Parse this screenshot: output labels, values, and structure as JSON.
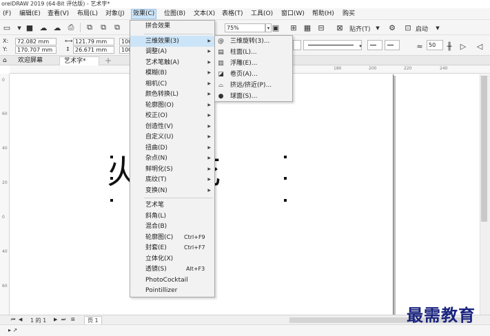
{
  "title": "orelDRAW 2019 (64-Bit 评估版) - 艺术字*",
  "menubar": [
    {
      "label": "(F)"
    },
    {
      "label": "编辑(E)"
    },
    {
      "label": "查看(V)"
    },
    {
      "label": "布局(L)"
    },
    {
      "label": "对象(J)"
    },
    {
      "label": "效果(C)"
    },
    {
      "label": "位图(B)"
    },
    {
      "label": "文本(X)"
    },
    {
      "label": "表格(T)"
    },
    {
      "label": "工具(O)"
    },
    {
      "label": "窗口(W)"
    },
    {
      "label": "帮助(H)"
    },
    {
      "label": "购买"
    }
  ],
  "toolbar": {
    "zoom_value": "75%",
    "align_label": "贴齐(T)",
    "launch_label": "启动"
  },
  "propbar": {
    "x_label": "X:",
    "x_value": "72.082 mm",
    "y_label": "Y:",
    "y_value": "170.707 mm",
    "w_value": "121.79 mm",
    "h_value": "26.671 mm",
    "scale1": "100",
    "scale2": "100",
    "spin_value": "50"
  },
  "tabs": [
    {
      "label": "欢迎屏幕"
    },
    {
      "label": "艺术字*"
    }
  ],
  "hruler_nums": [
    "180",
    "200",
    "220",
    "240"
  ],
  "vruler_nums": [
    "0",
    "60",
    "40",
    "20",
    "0",
    "40",
    "60"
  ],
  "canvas": {
    "art_text": "火 银花"
  },
  "effects_menu": {
    "items": [
      {
        "label": "拼合效果",
        "arrow": ""
      },
      {
        "label": "三维效果(3)",
        "arrow": "▶"
      },
      {
        "label": "调整(A)",
        "arrow": "▶"
      },
      {
        "label": "艺术笔触(A)",
        "arrow": "▶"
      },
      {
        "label": "模糊(B)",
        "arrow": "▶"
      },
      {
        "label": "相机(C)",
        "arrow": "▶"
      },
      {
        "label": "颜色转换(L)",
        "arrow": "▶"
      },
      {
        "label": "轮廓图(O)",
        "arrow": "▶"
      },
      {
        "label": "校正(O)",
        "arrow": "▶"
      },
      {
        "label": "创造性(V)",
        "arrow": "▶"
      },
      {
        "label": "自定义(U)",
        "arrow": "▶"
      },
      {
        "label": "扭曲(D)",
        "arrow": "▶"
      },
      {
        "label": "杂点(N)",
        "arrow": "▶"
      },
      {
        "label": "鲜明化(S)",
        "arrow": "▶"
      },
      {
        "label": "底纹(T)",
        "arrow": "▶"
      },
      {
        "label": "变换(N)",
        "arrow": "▶"
      }
    ],
    "items2": [
      {
        "label": "艺术笔",
        "shortcut": ""
      },
      {
        "label": "斜角(L)",
        "shortcut": ""
      },
      {
        "label": "混合(B)",
        "shortcut": ""
      },
      {
        "label": "轮廓图(C)",
        "shortcut": "Ctrl+F9"
      },
      {
        "label": "封套(E)",
        "shortcut": "Ctrl+F7"
      },
      {
        "label": "立体化(X)",
        "shortcut": ""
      },
      {
        "label": "透镜(S)",
        "shortcut": "Alt+F3"
      },
      {
        "label": "PhotoCocktail",
        "shortcut": ""
      },
      {
        "label": "Pointillizer",
        "shortcut": ""
      }
    ]
  },
  "submenu_3d": {
    "items": [
      {
        "label": "三维旋转(3)...",
        "icon": "@"
      },
      {
        "label": "柱面(L)...",
        "icon": "▤"
      },
      {
        "label": "浮雕(E)...",
        "icon": "▥"
      },
      {
        "label": "卷页(A)...",
        "icon": "◪"
      },
      {
        "label": "挤远/挤近(P)...",
        "icon": "⌓"
      },
      {
        "label": "球面(S)...",
        "icon": "●"
      }
    ]
  },
  "pagebar": {
    "nav_text": "1 的 1",
    "page_tab": "页 1"
  },
  "watermark": "最需教育",
  "colors": {
    "menu_highlight": "#cce4f7",
    "watermark": "#1a237e"
  }
}
